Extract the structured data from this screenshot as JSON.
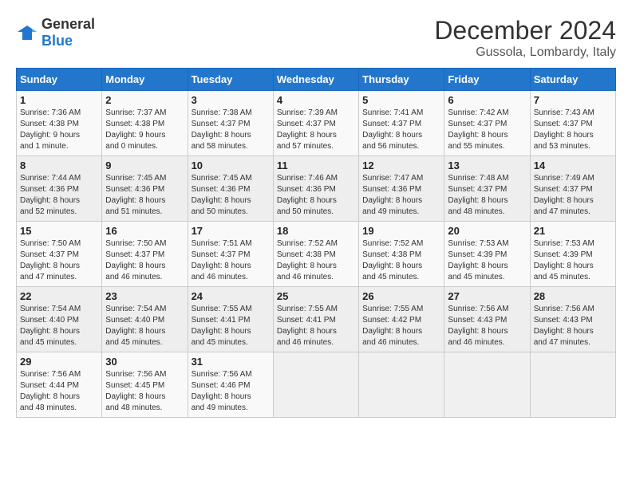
{
  "header": {
    "logo_general": "General",
    "logo_blue": "Blue",
    "title": "December 2024",
    "subtitle": "Gussola, Lombardy, Italy"
  },
  "calendar": {
    "days_of_week": [
      "Sunday",
      "Monday",
      "Tuesday",
      "Wednesday",
      "Thursday",
      "Friday",
      "Saturday"
    ],
    "weeks": [
      [
        {
          "day": "1",
          "info": "Sunrise: 7:36 AM\nSunset: 4:38 PM\nDaylight: 9 hours\nand 1 minute."
        },
        {
          "day": "2",
          "info": "Sunrise: 7:37 AM\nSunset: 4:38 PM\nDaylight: 9 hours\nand 0 minutes."
        },
        {
          "day": "3",
          "info": "Sunrise: 7:38 AM\nSunset: 4:37 PM\nDaylight: 8 hours\nand 58 minutes."
        },
        {
          "day": "4",
          "info": "Sunrise: 7:39 AM\nSunset: 4:37 PM\nDaylight: 8 hours\nand 57 minutes."
        },
        {
          "day": "5",
          "info": "Sunrise: 7:41 AM\nSunset: 4:37 PM\nDaylight: 8 hours\nand 56 minutes."
        },
        {
          "day": "6",
          "info": "Sunrise: 7:42 AM\nSunset: 4:37 PM\nDaylight: 8 hours\nand 55 minutes."
        },
        {
          "day": "7",
          "info": "Sunrise: 7:43 AM\nSunset: 4:37 PM\nDaylight: 8 hours\nand 53 minutes."
        }
      ],
      [
        {
          "day": "8",
          "info": "Sunrise: 7:44 AM\nSunset: 4:36 PM\nDaylight: 8 hours\nand 52 minutes."
        },
        {
          "day": "9",
          "info": "Sunrise: 7:45 AM\nSunset: 4:36 PM\nDaylight: 8 hours\nand 51 minutes."
        },
        {
          "day": "10",
          "info": "Sunrise: 7:45 AM\nSunset: 4:36 PM\nDaylight: 8 hours\nand 50 minutes."
        },
        {
          "day": "11",
          "info": "Sunrise: 7:46 AM\nSunset: 4:36 PM\nDaylight: 8 hours\nand 50 minutes."
        },
        {
          "day": "12",
          "info": "Sunrise: 7:47 AM\nSunset: 4:36 PM\nDaylight: 8 hours\nand 49 minutes."
        },
        {
          "day": "13",
          "info": "Sunrise: 7:48 AM\nSunset: 4:37 PM\nDaylight: 8 hours\nand 48 minutes."
        },
        {
          "day": "14",
          "info": "Sunrise: 7:49 AM\nSunset: 4:37 PM\nDaylight: 8 hours\nand 47 minutes."
        }
      ],
      [
        {
          "day": "15",
          "info": "Sunrise: 7:50 AM\nSunset: 4:37 PM\nDaylight: 8 hours\nand 47 minutes."
        },
        {
          "day": "16",
          "info": "Sunrise: 7:50 AM\nSunset: 4:37 PM\nDaylight: 8 hours\nand 46 minutes."
        },
        {
          "day": "17",
          "info": "Sunrise: 7:51 AM\nSunset: 4:37 PM\nDaylight: 8 hours\nand 46 minutes."
        },
        {
          "day": "18",
          "info": "Sunrise: 7:52 AM\nSunset: 4:38 PM\nDaylight: 8 hours\nand 46 minutes."
        },
        {
          "day": "19",
          "info": "Sunrise: 7:52 AM\nSunset: 4:38 PM\nDaylight: 8 hours\nand 45 minutes."
        },
        {
          "day": "20",
          "info": "Sunrise: 7:53 AM\nSunset: 4:39 PM\nDaylight: 8 hours\nand 45 minutes."
        },
        {
          "day": "21",
          "info": "Sunrise: 7:53 AM\nSunset: 4:39 PM\nDaylight: 8 hours\nand 45 minutes."
        }
      ],
      [
        {
          "day": "22",
          "info": "Sunrise: 7:54 AM\nSunset: 4:40 PM\nDaylight: 8 hours\nand 45 minutes."
        },
        {
          "day": "23",
          "info": "Sunrise: 7:54 AM\nSunset: 4:40 PM\nDaylight: 8 hours\nand 45 minutes."
        },
        {
          "day": "24",
          "info": "Sunrise: 7:55 AM\nSunset: 4:41 PM\nDaylight: 8 hours\nand 45 minutes."
        },
        {
          "day": "25",
          "info": "Sunrise: 7:55 AM\nSunset: 4:41 PM\nDaylight: 8 hours\nand 46 minutes."
        },
        {
          "day": "26",
          "info": "Sunrise: 7:55 AM\nSunset: 4:42 PM\nDaylight: 8 hours\nand 46 minutes."
        },
        {
          "day": "27",
          "info": "Sunrise: 7:56 AM\nSunset: 4:43 PM\nDaylight: 8 hours\nand 46 minutes."
        },
        {
          "day": "28",
          "info": "Sunrise: 7:56 AM\nSunset: 4:43 PM\nDaylight: 8 hours\nand 47 minutes."
        }
      ],
      [
        {
          "day": "29",
          "info": "Sunrise: 7:56 AM\nSunset: 4:44 PM\nDaylight: 8 hours\nand 48 minutes."
        },
        {
          "day": "30",
          "info": "Sunrise: 7:56 AM\nSunset: 4:45 PM\nDaylight: 8 hours\nand 48 minutes."
        },
        {
          "day": "31",
          "info": "Sunrise: 7:56 AM\nSunset: 4:46 PM\nDaylight: 8 hours\nand 49 minutes."
        },
        {
          "day": "",
          "info": ""
        },
        {
          "day": "",
          "info": ""
        },
        {
          "day": "",
          "info": ""
        },
        {
          "day": "",
          "info": ""
        }
      ]
    ]
  }
}
